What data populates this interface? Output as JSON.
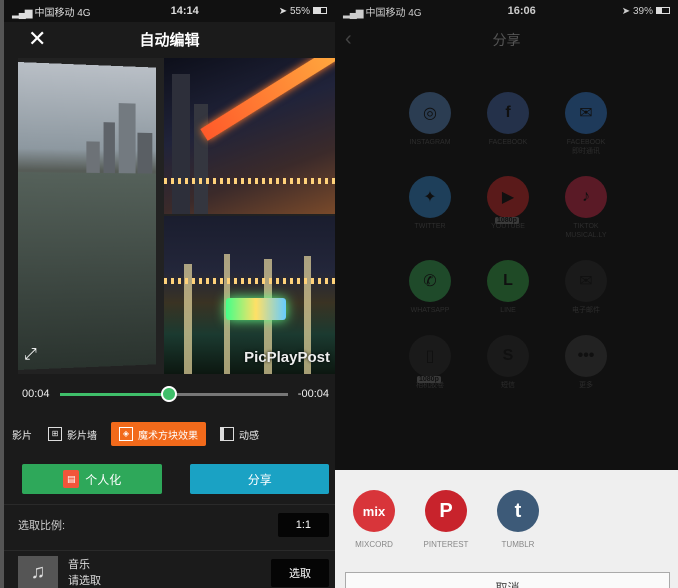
{
  "left": {
    "status": {
      "carrier": "中国移动",
      "network": "4G",
      "time": "14:14",
      "battery": "55%",
      "battery_level": 0.55
    },
    "header": {
      "title": "自动编辑",
      "close_icon": "✕"
    },
    "preview": {
      "watermark": "PicPlayPost"
    },
    "timeline": {
      "start": "00:04",
      "end": "-00:04",
      "progress": 0.48
    },
    "tabs": [
      {
        "label": "影片",
        "icon": "film-icon"
      },
      {
        "label": "影片墙",
        "icon": "grid-icon"
      },
      {
        "label": "魔术方块效果",
        "icon": "cube-icon"
      },
      {
        "label": "动感",
        "icon": "motion-icon"
      }
    ],
    "buttons": {
      "personalize": "个人化",
      "share": "分享"
    },
    "ratio": {
      "label": "选取比例:",
      "value": "1:1"
    },
    "music": {
      "title": "音乐",
      "subtitle": "请选取",
      "button": "选取"
    }
  },
  "right": {
    "status": {
      "carrier": "中国移动",
      "network": "4G",
      "time": "16:06",
      "battery": "39%",
      "battery_level": 0.39
    },
    "header": {
      "title": "分享"
    },
    "grid": [
      {
        "label": "INSTAGRAM",
        "color": "#2b3d52",
        "glyph": "◎"
      },
      {
        "label": "FACEBOOK",
        "color": "#24314a",
        "glyph": "f"
      },
      {
        "label": "FACEBOOK\n即时通讯",
        "color": "#1e3a5a",
        "glyph": "✉"
      },
      {
        "label": "TWITTER",
        "color": "#1e3f5a",
        "glyph": "✦"
      },
      {
        "label": "YOUTUBE",
        "color": "#5a1a1a",
        "glyph": "▶",
        "badge": "1080p"
      },
      {
        "label": "TIKTOK\nMUSICAL.LY",
        "color": "#5a1a26",
        "glyph": "♪"
      },
      {
        "label": "WHATSAPP",
        "color": "#1f4a2a",
        "glyph": "✆"
      },
      {
        "label": "LINE",
        "color": "#1f4a26",
        "glyph": "L"
      },
      {
        "label": "电子邮件",
        "color": "#1a1a1a",
        "glyph": "✉"
      },
      {
        "label": "相机胶卷",
        "color": "#1a1a1a",
        "glyph": "▯",
        "badge": "1080p"
      },
      {
        "label": "短信",
        "color": "#1a1a1a",
        "glyph": "S"
      },
      {
        "label": "更多",
        "color": "#222222",
        "glyph": "•••"
      }
    ],
    "sheet": [
      {
        "label": "MIXCORD",
        "color": "#d8353a",
        "glyph": "mix"
      },
      {
        "label": "PINTEREST",
        "color": "#c8232c",
        "glyph": "P"
      },
      {
        "label": "TUMBLR",
        "color": "#3d5a78",
        "glyph": "t"
      }
    ],
    "cancel": "取消"
  }
}
